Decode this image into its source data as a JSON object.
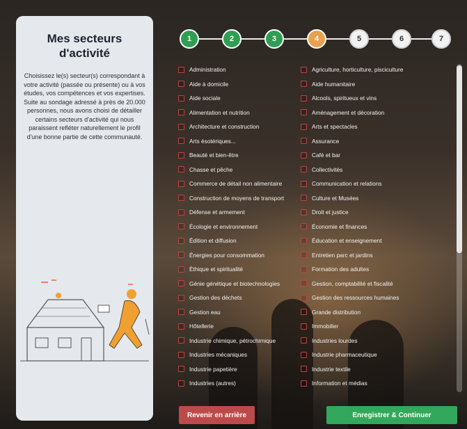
{
  "left_panel": {
    "title": "Mes secteurs d'activité",
    "description": "Choisissez le(s) secteur(s) correspondant à votre activité (passée ou présente) ou à vos études, vos compétences et vos expertises. Suite au sondage adressé à près de 20.000 personnes, nous avons choisi de détailler certains secteurs d'activité qui nous paraissent refléter naturellement le profil d'une bonne partie de cette communauté."
  },
  "stepper": {
    "steps": [
      {
        "label": "1",
        "state": "done"
      },
      {
        "label": "2",
        "state": "done"
      },
      {
        "label": "3",
        "state": "done"
      },
      {
        "label": "4",
        "state": "current"
      },
      {
        "label": "5",
        "state": "todo"
      },
      {
        "label": "6",
        "state": "todo"
      },
      {
        "label": "7",
        "state": "todo"
      }
    ]
  },
  "sectors": {
    "left": [
      "Administration",
      "Aide à domicile",
      "Aide sociale",
      "Alimentation et nutrition",
      "Architecture et construction",
      "Arts ésotériques...",
      "Beauté et bien-être",
      "Chasse et pêche",
      "Commerce de détail non alimentaire",
      "Construction de moyens de transport",
      "Défense et armement",
      "Écologie et environnement",
      "Édition et diffusion",
      "Énergies pour consommation",
      "Éthique et spiritualité",
      "Génie génétique et biotechnologies",
      "Gestion des déchets",
      "Gestion eau",
      "Hôtellerie",
      "Industrie chimique, pétrochimique",
      "Industries mécaniques",
      "Industrie papetière",
      "Industries (autres)"
    ],
    "right": [
      "Agriculture, horticulture, pisciculture",
      "Aide humanitaire",
      "Alcools, spiritueux et vins",
      "Aménagement et décoration",
      "Arts et spectacles",
      "Assurance",
      "Café et bar",
      "Collectivités",
      "Communication et relations",
      "Culture et Musées",
      "Droit et justice",
      "Économie et finances",
      "Éducation et enseignement",
      "Entretien parc et jardins",
      "Formation des adultes",
      "Gestion, comptabilité et fiscalité",
      "Gestion des ressources humaines",
      "Grande distribution",
      "Immobilier",
      "Industries lourdes",
      "Industrie pharmaceutique",
      "Industrie textile",
      "Information et médias"
    ]
  },
  "buttons": {
    "back": "Revenir en arrière",
    "next": "Enregistrer & Continuer"
  },
  "colors": {
    "done": "#2f9e52",
    "current": "#e9a04f",
    "back": "#bd4a4a",
    "next": "#31a85b"
  }
}
